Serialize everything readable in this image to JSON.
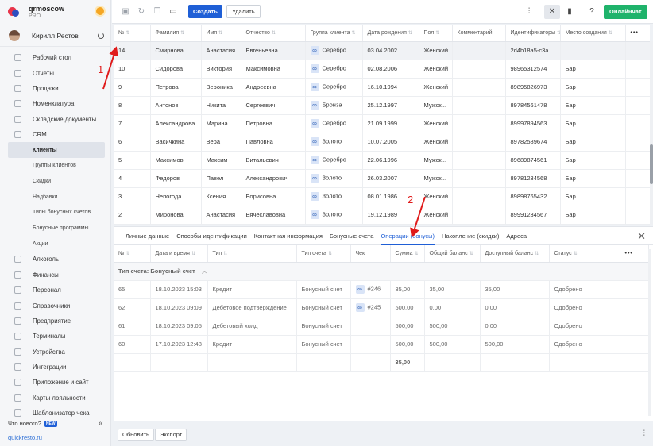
{
  "brand": {
    "name": "qrmoscow",
    "plan": "PRO"
  },
  "user": {
    "name": "Кирилл Рестов"
  },
  "sidebar": {
    "items": [
      {
        "label": "Рабочий стол",
        "sub": false
      },
      {
        "label": "Отчеты",
        "sub": false
      },
      {
        "label": "Продажи",
        "sub": false
      },
      {
        "label": "Номенклатура",
        "sub": false
      },
      {
        "label": "Складские документы",
        "sub": false
      },
      {
        "label": "CRM",
        "sub": false
      },
      {
        "label": "Клиенты",
        "sub": true,
        "active": true
      },
      {
        "label": "Группы клиентов",
        "sub": true
      },
      {
        "label": "Скидки",
        "sub": true
      },
      {
        "label": "Надбавки",
        "sub": true
      },
      {
        "label": "Типы бонусных счетов",
        "sub": true
      },
      {
        "label": "Бонусные программы",
        "sub": true
      },
      {
        "label": "Акции",
        "sub": true
      },
      {
        "label": "Алкоголь",
        "sub": false
      },
      {
        "label": "Финансы",
        "sub": false
      },
      {
        "label": "Персонал",
        "sub": false
      },
      {
        "label": "Справочники",
        "sub": false
      },
      {
        "label": "Предприятие",
        "sub": false
      },
      {
        "label": "Терминалы",
        "sub": false
      },
      {
        "label": "Устройства",
        "sub": false
      },
      {
        "label": "Интеграции",
        "sub": false
      },
      {
        "label": "Приложение и сайт",
        "sub": false
      },
      {
        "label": "Карты лояльности",
        "sub": false
      },
      {
        "label": "Шаблонизатор чека",
        "sub": false
      }
    ],
    "whats_new": "Что нового?",
    "new_badge": "NEW",
    "site": "quickresto.ru"
  },
  "toolbar": {
    "create_label": "Создать",
    "delete_label": "Удалить",
    "chat_label": "Онлайнчат"
  },
  "main_table": {
    "columns": [
      "№",
      "Фамилия",
      "Имя",
      "Отчество",
      "Группа клиента",
      "Дата рождения",
      "Пол",
      "Комментарий",
      "Идентификаторы",
      "Место создания"
    ],
    "rows": [
      {
        "num": "14",
        "last": "Смирнова",
        "first": "Анастасия",
        "middle": "Евгеньевна",
        "group": "Серебро",
        "birth": "03.04.2002",
        "sex": "Женский",
        "comment": "",
        "ids": "2d4b18a5-c3a...",
        "place": ""
      },
      {
        "num": "10",
        "last": "Сидорова",
        "first": "Виктория",
        "middle": "Максимовна",
        "group": "Серебро",
        "birth": "02.08.2006",
        "sex": "Женский",
        "comment": "",
        "ids": "98965312574",
        "place": "Бар"
      },
      {
        "num": "9",
        "last": "Петрова",
        "first": "Вероника",
        "middle": "Андреевна",
        "group": "Серебро",
        "birth": "16.10.1994",
        "sex": "Женский",
        "comment": "",
        "ids": "89895826973",
        "place": "Бар"
      },
      {
        "num": "8",
        "last": "Антонов",
        "first": "Никита",
        "middle": "Сергеевич",
        "group": "Бронза",
        "birth": "25.12.1997",
        "sex": "Мужск...",
        "comment": "",
        "ids": "89784561478",
        "place": "Бар"
      },
      {
        "num": "7",
        "last": "Александрова",
        "first": "Марина",
        "middle": "Петровна",
        "group": "Серебро",
        "birth": "21.09.1999",
        "sex": "Женский",
        "comment": "",
        "ids": "89997894563",
        "place": "Бар"
      },
      {
        "num": "6",
        "last": "Васичкина",
        "first": "Вера",
        "middle": "Павловна",
        "group": "Золото",
        "birth": "10.07.2005",
        "sex": "Женский",
        "comment": "",
        "ids": "89782589674",
        "place": "Бар"
      },
      {
        "num": "5",
        "last": "Максимов",
        "first": "Максим",
        "middle": "Витальевич",
        "group": "Серебро",
        "birth": "22.06.1996",
        "sex": "Мужск...",
        "comment": "",
        "ids": "89689874561",
        "place": "Бар"
      },
      {
        "num": "4",
        "last": "Федоров",
        "first": "Павел",
        "middle": "Александрович",
        "group": "Золото",
        "birth": "26.03.2007",
        "sex": "Мужск...",
        "comment": "",
        "ids": "89781234568",
        "place": "Бар"
      },
      {
        "num": "3",
        "last": "Непогода",
        "first": "Ксения",
        "middle": "Борисовна",
        "group": "Золото",
        "birth": "08.01.1986",
        "sex": "Женский",
        "comment": "",
        "ids": "89898765432",
        "place": "Бар"
      },
      {
        "num": "2",
        "last": "Миронова",
        "first": "Анастасия",
        "middle": "Вячеславовна",
        "group": "Золото",
        "birth": "19.12.1989",
        "sex": "Женский",
        "comment": "",
        "ids": "89991234567",
        "place": "Бар"
      }
    ]
  },
  "panel": {
    "tabs": [
      "Личные данные",
      "Способы идентификации",
      "Контактная информация",
      "Бонусные счета",
      "Операции (бонусы)",
      "Накопление (скидки)",
      "Адреса"
    ],
    "active_tab": 4,
    "columns": [
      "№",
      "Дата и время",
      "Тип",
      "Тип счета",
      "Чек",
      "Сумма",
      "Общий баланс",
      "Доступный баланс",
      "Статус"
    ],
    "group_label": "Тип счета: Бонусный счет",
    "rows": [
      {
        "num": "65",
        "datetime": "18.10.2023 15:03",
        "type": "Кредит",
        "account": "Бонусный счет",
        "check": "#246",
        "sum": "35,00",
        "total": "35,00",
        "available": "35,00",
        "status": "Одобрено"
      },
      {
        "num": "62",
        "datetime": "18.10.2023 09:09",
        "type": "Дебетовое подтверждение",
        "account": "Бонусный счет",
        "check": "#245",
        "sum": "500,00",
        "total": "0,00",
        "available": "0,00",
        "status": "Одобрено"
      },
      {
        "num": "61",
        "datetime": "18.10.2023 09:05",
        "type": "Дебетовый холд",
        "account": "Бонусный счет",
        "check": "",
        "sum": "500,00",
        "total": "500,00",
        "available": "0,00",
        "status": "Одобрено"
      },
      {
        "num": "60",
        "datetime": "17.10.2023 12:48",
        "type": "Кредит",
        "account": "Бонусный счет",
        "check": "",
        "sum": "500,00",
        "total": "500,00",
        "available": "500,00",
        "status": "Одобрено"
      }
    ],
    "total_sum": "35,00"
  },
  "bottombar": {
    "refresh_label": "Обновить",
    "export_label": "Экспорт"
  },
  "annotations": {
    "one": "1",
    "two": "2"
  },
  "colors": {
    "accent": "#1f5fd6",
    "chat": "#1fb36b",
    "annotation": "#e01b1b"
  }
}
